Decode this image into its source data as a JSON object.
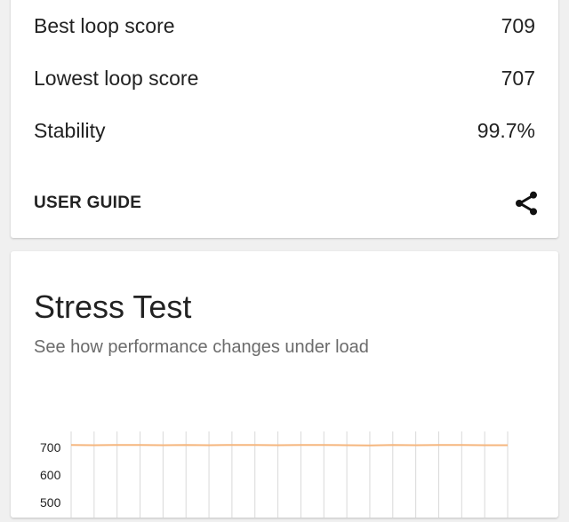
{
  "summary": {
    "rows": [
      {
        "label": "Best loop score",
        "value": "709"
      },
      {
        "label": "Lowest loop score",
        "value": "707"
      },
      {
        "label": "Stability",
        "value": "99.7%"
      }
    ],
    "user_guide_label": "USER GUIDE",
    "share_icon": "share-icon"
  },
  "stress_test": {
    "title": "Stress Test",
    "subtitle": "See how performance changes under load"
  },
  "chart_data": {
    "type": "line",
    "y_ticks": [
      "700",
      "600",
      "500"
    ],
    "ylim": [
      500,
      700
    ],
    "x_count": 20,
    "series": [
      {
        "values": [
          709,
          708,
          709,
          709,
          708,
          709,
          708,
          709,
          709,
          708,
          709,
          709,
          708,
          707,
          709,
          708,
          709,
          709,
          708,
          708
        ]
      }
    ],
    "line_color": "#f5b67e",
    "grid_color": "#d9d9d9",
    "grid": true
  }
}
